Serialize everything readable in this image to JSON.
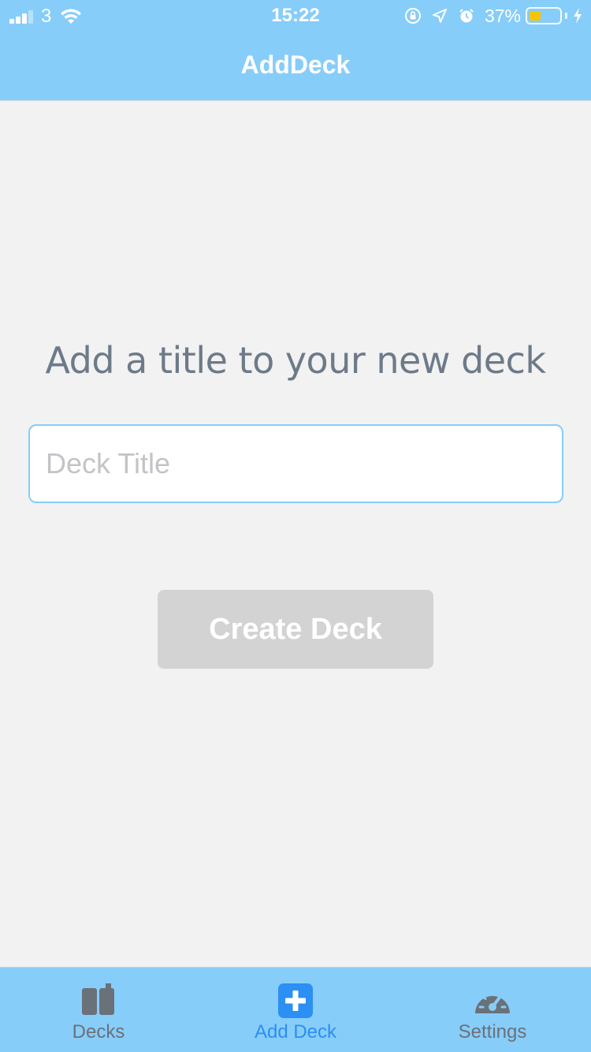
{
  "status_bar": {
    "carrier": "3",
    "time": "15:22",
    "battery_percent": "37%",
    "battery_level": 0.37,
    "icons": [
      "signal-icon",
      "wifi-icon",
      "orientation-lock-icon",
      "location-icon",
      "alarm-icon",
      "battery-icon",
      "charging-bolt-icon"
    ]
  },
  "header": {
    "title": "AddDeck"
  },
  "main": {
    "prompt": "Add a title to your new deck",
    "title_input": {
      "value": "",
      "placeholder": "Deck Title"
    },
    "create_button_label": "Create Deck"
  },
  "tab_bar": {
    "tabs": [
      {
        "label": "Decks",
        "icon": "deck-cards-icon",
        "active": false
      },
      {
        "label": "Add Deck",
        "icon": "plus-square-icon",
        "active": true
      },
      {
        "label": "Settings",
        "icon": "speedometer-icon",
        "active": false
      }
    ]
  },
  "colors": {
    "header_bg": "#87cdf9",
    "background": "#f2f2f2",
    "prompt_text": "#6d7a89",
    "button_disabled": "#d3d3d3",
    "tab_active": "#2b8ff3",
    "tab_inactive": "#6a7178"
  }
}
